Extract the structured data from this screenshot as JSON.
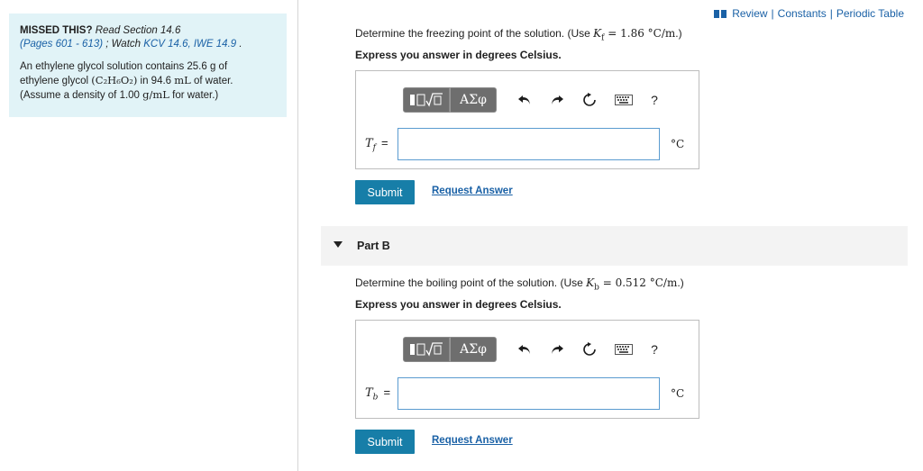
{
  "sidebar": {
    "missed_label": "MISSED THIS?",
    "read_text": "Read Section 14.6",
    "pages_text": "(Pages 601 - 613)",
    "watch_sep": "; Watch",
    "watch_links": "KCV 14.6, IWE 14.9",
    "period": ".",
    "intro_1": "An ethylene glycol solution contains 25.6 g of",
    "intro_2a": "ethylene glycol ",
    "intro_formula": "(C₂H₆O₂)",
    "intro_2b": " in 94.6 ",
    "intro_unit_ml": "mL",
    "intro_2c": " of water.",
    "intro_3a": "(Assume a density of 1.00 ",
    "intro_density_unit": "g/mL",
    "intro_3b": " for water.)"
  },
  "toplinks": {
    "review": "Review",
    "sep": "|",
    "constants": "Constants",
    "periodic": "Periodic Table"
  },
  "part_a": {
    "question_pre": "Determine the freezing point of the solution. (Use ",
    "question_const": "K",
    "question_sub": "f",
    "question_val": " = 1.86 °C/m",
    "question_post": ".)",
    "express": "Express you answer in degrees Celsius.",
    "label_var": "T",
    "label_sub": "f",
    "label_eq": "=",
    "input_value": "",
    "unit": "°C",
    "submit": "Submit",
    "request": "Request Answer"
  },
  "part_b": {
    "title": "Part B",
    "question_pre": "Determine the boiling point of the solution. (Use ",
    "question_const": "K",
    "question_sub": "b",
    "question_val": " = 0.512 °C/m",
    "question_post": ".)",
    "express": "Express you answer in degrees Celsius.",
    "label_var": "T",
    "label_sub": "b",
    "label_eq": "=",
    "input_value": "",
    "unit": "°C",
    "submit": "Submit",
    "request": "Request Answer"
  },
  "toolbar": {
    "greek": "ΑΣφ",
    "help": "?",
    "icons": [
      "templates-icon",
      "greek-symbols-icon",
      "undo-icon",
      "redo-icon",
      "reset-icon",
      "keyboard-icon",
      "help-icon"
    ]
  },
  "colors": {
    "link": "#1a61a6",
    "submit_bg": "#177ea8",
    "hint_bg": "#e1f3f7",
    "input_border": "#5a9bd0"
  }
}
